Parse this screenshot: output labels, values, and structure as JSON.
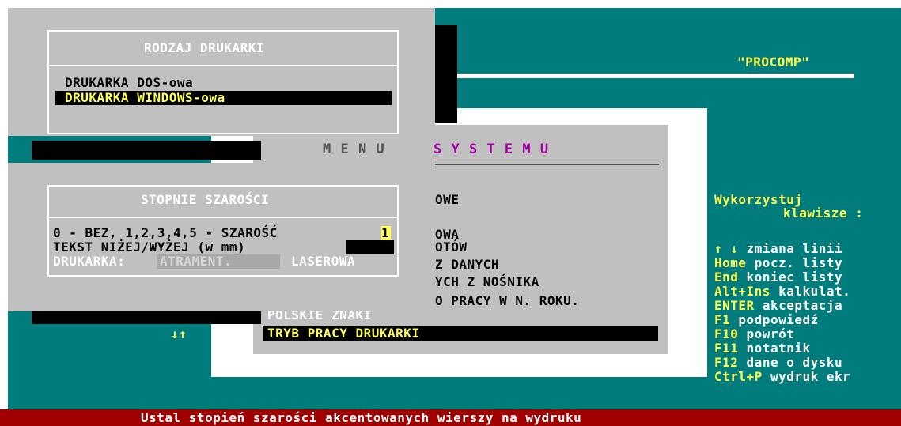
{
  "app": {
    "company": "\"PROCOMP\"",
    "status_bar": "Ustal stopień szarości akcentowanych wierszy na wydruku"
  },
  "menu": {
    "title_left": "M E N U",
    "title_right": "S Y S T E M U",
    "items": [
      {
        "label": "OWE"
      },
      {
        "label": "OWA"
      },
      {
        "label": "OTÓW"
      },
      {
        "label": "Z DANYCH"
      },
      {
        "label": "YCH Z NOŚNIKA"
      },
      {
        "label": "O PRACY W N. ROKU."
      },
      {
        "label": "POLSKIE ZNAKI"
      },
      {
        "label": "TRYB PRACY DRUKARKI"
      }
    ],
    "scroll_arrows": "↓↑"
  },
  "printer_type": {
    "title": "RODZAJ DRUKARKI",
    "options": [
      {
        "label": "DRUKARKA DOS-owa",
        "selected": false
      },
      {
        "label": "DRUKARKA WINDOWS-owa",
        "selected": true
      }
    ]
  },
  "grayscale": {
    "title": "STOPNIE SZAROŚCI",
    "line1_label": "0 - BEZ, 1,2,3,4,5 - SZAROŚĆ",
    "line1_value": "1",
    "line2_label": "TEKST NIŻEJ/WYŻEJ (w mm)",
    "line2_value": "",
    "printer_label": "DRUKARKA:",
    "printer_option_ink": "ATRAMENT.",
    "printer_option_laser": "LASEROWA"
  },
  "help": {
    "title_line1": "Wykorzystuj",
    "title_line2": "klawisze :",
    "keys": [
      {
        "key": "↑ ↓",
        "desc": "zmiana linii"
      },
      {
        "key": "Home",
        "desc": "pocz. listy"
      },
      {
        "key": "End",
        "desc": "koniec listy"
      },
      {
        "key": "Alt+Ins",
        "desc": "kalkulat."
      },
      {
        "key": "ENTER",
        "desc": "akceptacja"
      },
      {
        "key": "F1",
        "desc": "podpowiedź"
      },
      {
        "key": "F10",
        "desc": "powrót"
      },
      {
        "key": "F11",
        "desc": "notatnik"
      },
      {
        "key": "F12",
        "desc": "dane o dysku"
      },
      {
        "key": "Ctrl+P",
        "desc": "wydruk ekr"
      }
    ]
  },
  "colors": {
    "teal": "#007c7c",
    "panel_gray": "#c0c0c0",
    "yellow": "#ffff55",
    "title_purple": "#a000a0",
    "status_red": "#a00000"
  }
}
